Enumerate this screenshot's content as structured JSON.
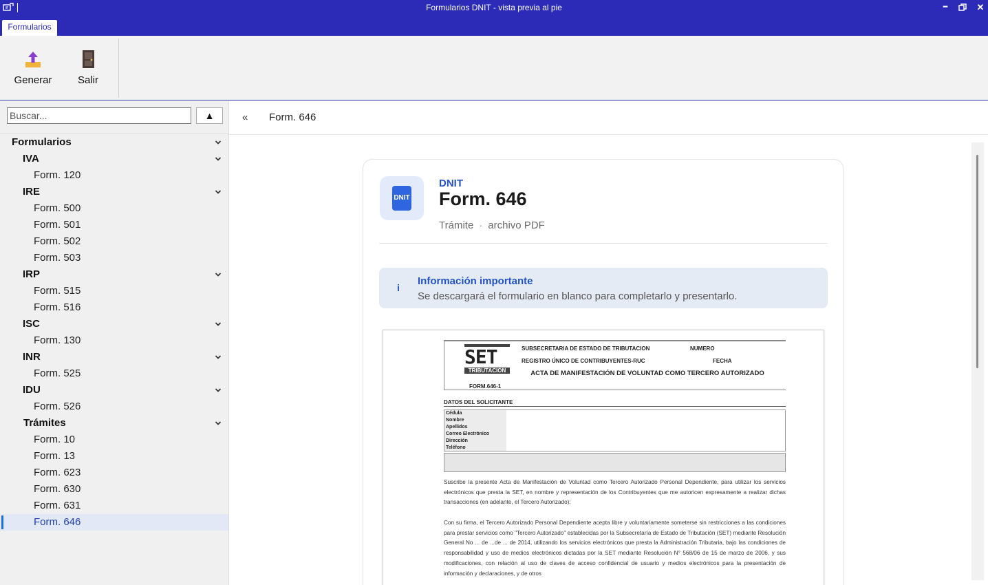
{
  "window": {
    "title": "Formularios DNIT - vista previa al pie",
    "tab": "Formularios",
    "min_glyph": "━",
    "max_glyph": "🗗",
    "close_glyph": "✕",
    "icon": "app-icon"
  },
  "ribbon": {
    "generar_label": "Generar",
    "salir_label": "Salir"
  },
  "sidebar": {
    "search_placeholder": "Buscar...",
    "collapse_glyph": "▲",
    "tree": [
      {
        "label": "Formularios",
        "level": 0,
        "expandable": true
      },
      {
        "label": "IVA",
        "level": 1,
        "expandable": true
      },
      {
        "label": "Form. 120",
        "level": 2
      },
      {
        "label": "IRE",
        "level": 1,
        "expandable": true
      },
      {
        "label": "Form. 500",
        "level": 2
      },
      {
        "label": "Form. 501",
        "level": 2
      },
      {
        "label": "Form. 502",
        "level": 2
      },
      {
        "label": "Form. 503",
        "level": 2
      },
      {
        "label": "IRP",
        "level": 1,
        "expandable": true
      },
      {
        "label": "Form. 515",
        "level": 2
      },
      {
        "label": "Form. 516",
        "level": 2
      },
      {
        "label": "ISC",
        "level": 1,
        "expandable": true
      },
      {
        "label": "Form. 130",
        "level": 2
      },
      {
        "label": "INR",
        "level": 1,
        "expandable": true
      },
      {
        "label": "Form. 525",
        "level": 2
      },
      {
        "label": "IDU",
        "level": 1,
        "expandable": true
      },
      {
        "label": "Form. 526",
        "level": 2
      },
      {
        "label": "Trámites",
        "level": 1,
        "expandable": true
      },
      {
        "label": "Form. 10",
        "level": 2
      },
      {
        "label": "Form. 13",
        "level": 2
      },
      {
        "label": "Form. 623",
        "level": 2
      },
      {
        "label": "Form. 630",
        "level": 2
      },
      {
        "label": "Form. 631",
        "level": 2
      },
      {
        "label": "Form. 646",
        "level": 2,
        "selected": true
      }
    ]
  },
  "main": {
    "back_glyph": "«",
    "breadcrumb": "Form. 646",
    "card": {
      "logo_text": "DNIT",
      "org": "DNIT",
      "title": "Form. 646",
      "meta_type": "Trámite",
      "meta_sep": "·",
      "meta_format": "archivo PDF",
      "info_icon": "i",
      "info_title": "Información importante",
      "info_text": "Se descargará el formulario en blanco para completarlo y presentarlo."
    },
    "preview": {
      "logo_main": "SET",
      "logo_sub": "TRIBUTACION",
      "line1": "SUBSECRETARIA DE ESTADO DE TRIBUTACION",
      "line2": "REGISTRO ÚNICO DE CONTRIBUYENTES-RUC",
      "numero": "NUMERO",
      "fecha": "FECHA",
      "acta": "ACTA DE MANIFESTACIÓN DE VOLUNTAD COMO TERCERO AUTORIZADO",
      "form_no": "FORM.646-1",
      "datos": "DATOS DEL SOLICITANTE",
      "fields": [
        "Cédula",
        "Nombre",
        "Apellidos",
        "Correo Electrónico",
        "Dirección",
        "Teléfono"
      ],
      "para1": "Suscribe la presente Acta de Manifestación de Voluntad como Tercero Autorizado Personal Dependiente, para utilizar los servicios electrónicos que presta la SET, en nombre y representación de los Contribuyentes que me autoricen expresamente a realizar dichas transacciones (en adelante, el Tercero Autorizado):",
      "para2": "Con su firma, el Tercero Autorizado Personal Dependiente acepta libre y voluntariamente someterse sin restricciones a las condiciones para prestar servicios como \"Tercero Autorizado\" establecidas por la Subsecretaría de Estado de Tributación (SET) mediante Resolución General No ... de ...de ... de 2014, utilizando los servicios electrónicos que presta la Administración Tributaria, bajo las condiciones de responsabilidad y uso de medios electrónicos dictadas por la SET mediante Resolución N° 568/06 de 15 de marzo de 2006, y sus modificaciones, con relación al uso de claves de acceso confidencial de usuario y medios electrónicos para la presentación de información y declaraciones, y de otros"
    }
  }
}
